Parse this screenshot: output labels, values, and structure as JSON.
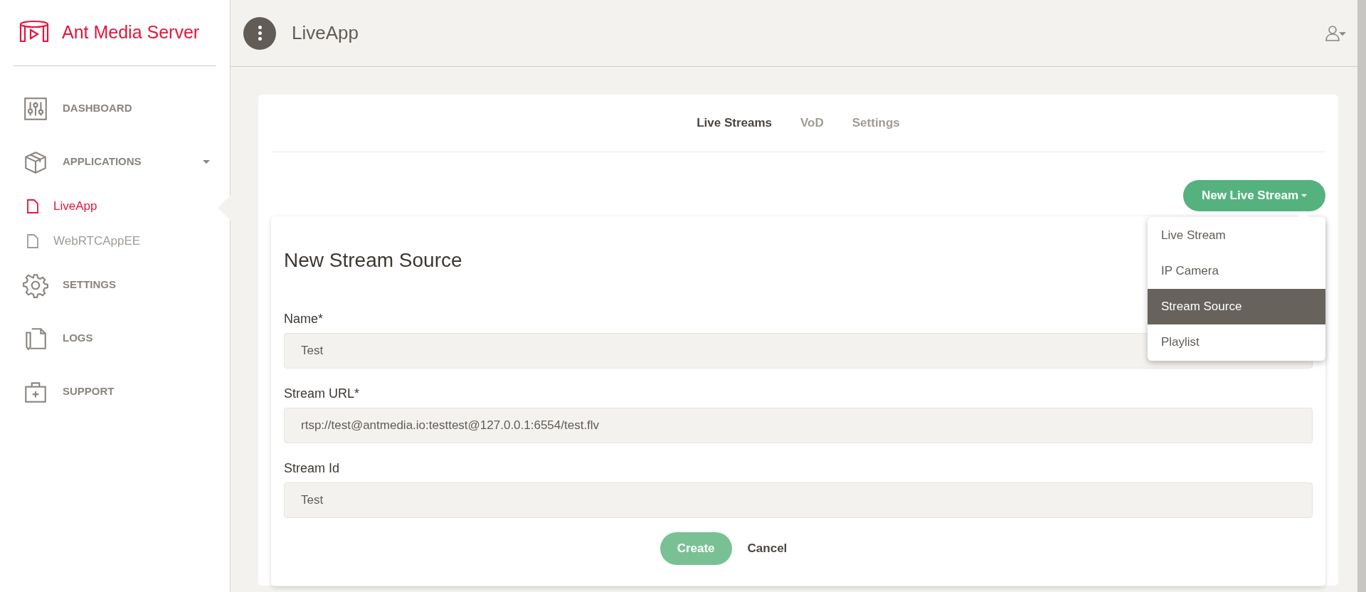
{
  "brand": {
    "name": "Ant Media Server"
  },
  "sidebar": {
    "items": [
      {
        "kind": "section",
        "label": "DASHBOARD"
      },
      {
        "kind": "section",
        "label": "APPLICATIONS",
        "expanded": true,
        "children": [
          {
            "label": "LiveApp",
            "selected": true
          },
          {
            "label": "WebRTCAppEE",
            "selected": false
          }
        ]
      },
      {
        "kind": "section",
        "label": "SETTINGS"
      },
      {
        "kind": "section",
        "label": "LOGS"
      },
      {
        "kind": "section",
        "label": "SUPPORT"
      }
    ]
  },
  "topbar": {
    "title": "LiveApp"
  },
  "tabs": [
    {
      "label": "Live Streams",
      "selected": true
    },
    {
      "label": "VoD",
      "selected": false
    },
    {
      "label": "Settings",
      "selected": false
    }
  ],
  "new_button": {
    "label": "New Live Stream"
  },
  "menu": {
    "items": [
      {
        "label": "Live Stream",
        "selected": false
      },
      {
        "label": "IP Camera",
        "selected": false
      },
      {
        "label": "Stream Source",
        "selected": true
      },
      {
        "label": "Playlist",
        "selected": false
      }
    ]
  },
  "form": {
    "title": "New Stream Source",
    "fields": [
      {
        "label": "Name*",
        "value": "Test"
      },
      {
        "label": "Stream URL*",
        "value": "rtsp://test@antmedia.io:testtest@127.0.0.1:6554/test.flv"
      },
      {
        "label": "Stream Id",
        "value": "Test"
      }
    ],
    "buttons": [
      {
        "kind": "primary",
        "label": "Create"
      },
      {
        "kind": "plain",
        "label": "Cancel"
      }
    ]
  }
}
